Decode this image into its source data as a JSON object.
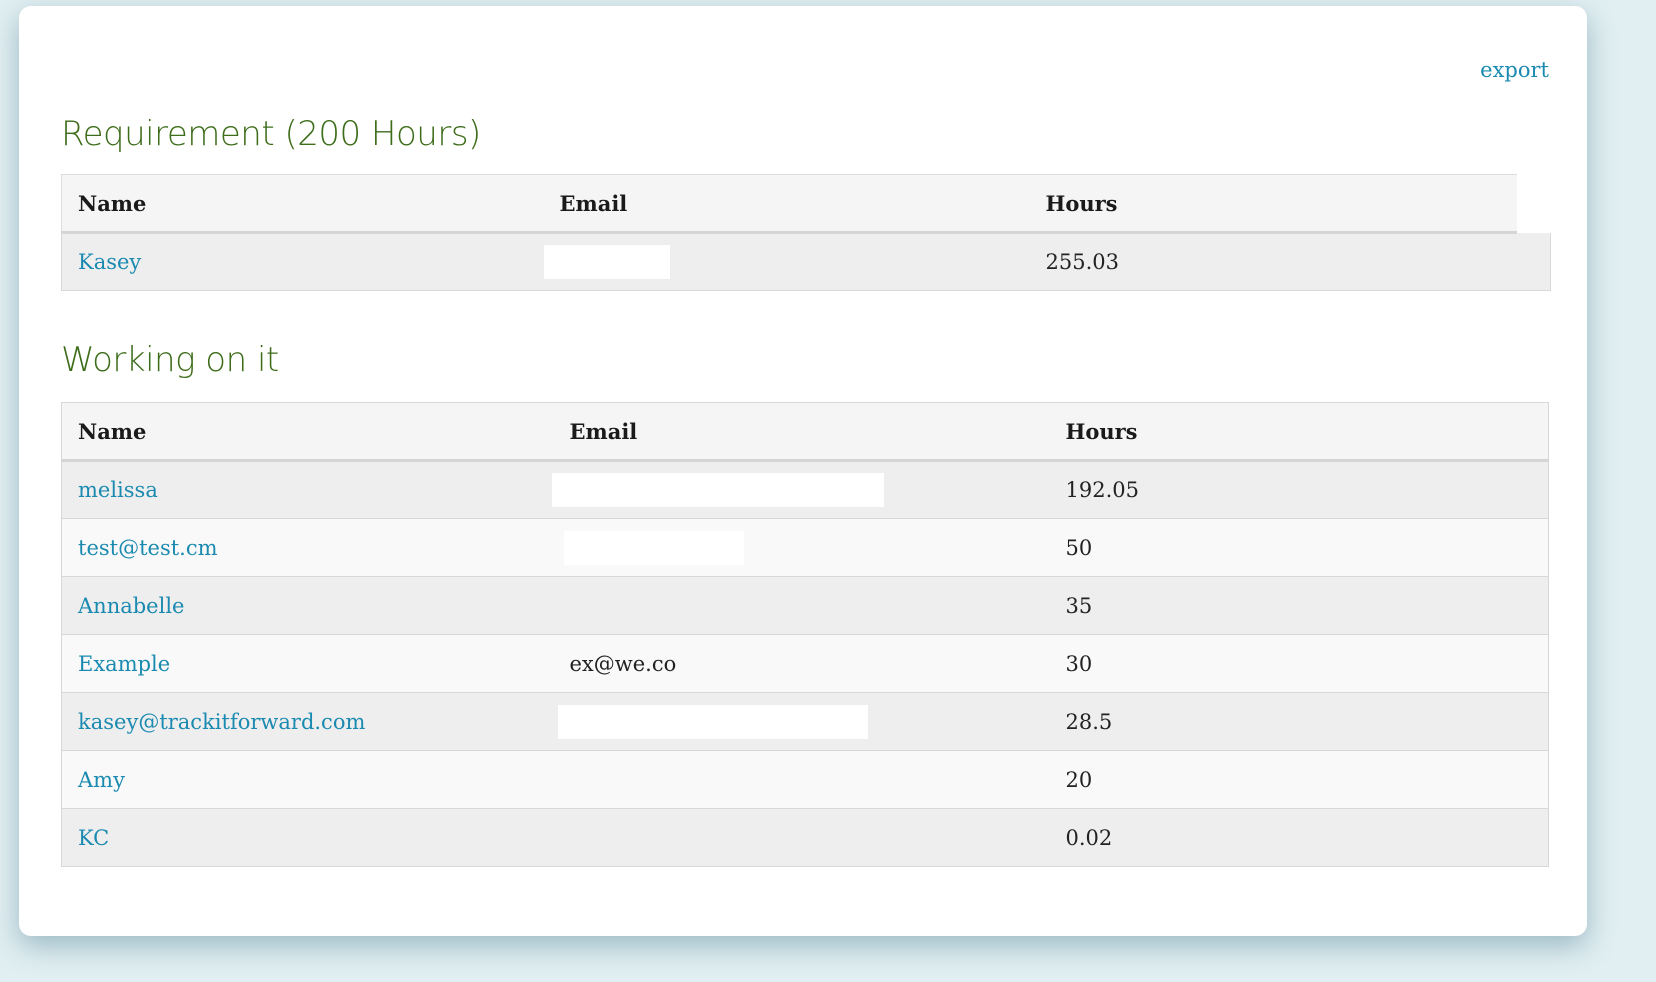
{
  "export_label": "export",
  "requirement": {
    "title": "Requirement (200 Hours)",
    "columns": [
      "Name",
      "Email",
      "Hours"
    ],
    "rows": [
      {
        "name": "Kasey",
        "email": "",
        "hours": "255.03"
      }
    ]
  },
  "working": {
    "title": "Working on it",
    "columns": [
      "Name",
      "Email",
      "Hours"
    ],
    "rows": [
      {
        "name": "melissa",
        "email": "",
        "hours": "192.05"
      },
      {
        "name": "test@test.cm",
        "email": "",
        "hours": "50"
      },
      {
        "name": "Annabelle",
        "email": "",
        "hours": "35"
      },
      {
        "name": "Example",
        "email": "ex@we.co",
        "hours": "30"
      },
      {
        "name": "kasey@trackitforward.com",
        "email": "",
        "hours": "28.5"
      },
      {
        "name": "Amy",
        "email": "",
        "hours": "20"
      },
      {
        "name": "KC",
        "email": "",
        "hours": "0.02"
      }
    ]
  },
  "colors": {
    "title_green": "#3d6d1a",
    "link_blue": "#1a8ab0",
    "background": "#e1eff2"
  }
}
